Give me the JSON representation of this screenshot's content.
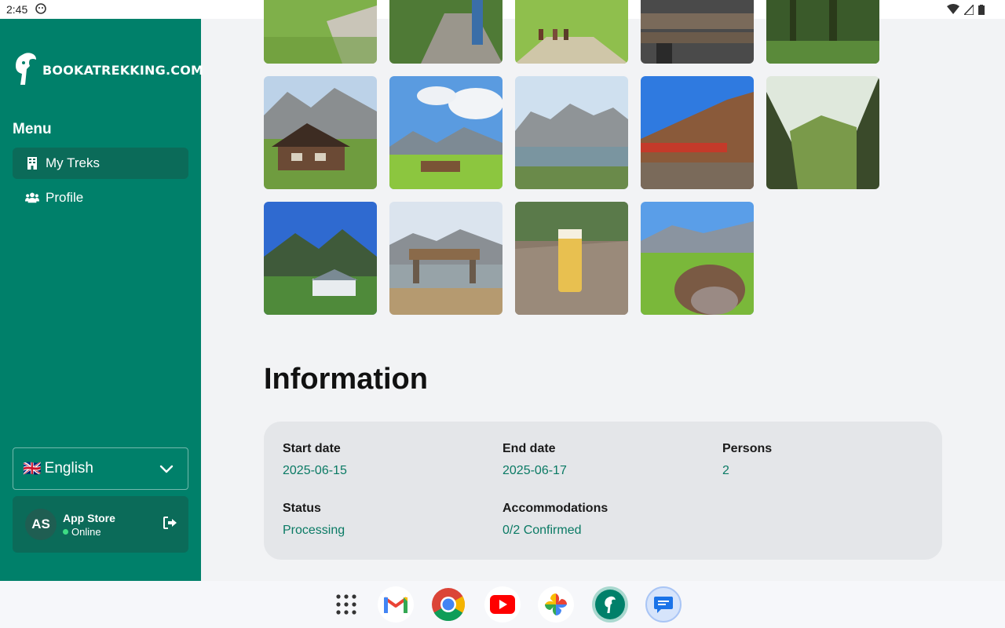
{
  "status_bar": {
    "time": "2:45"
  },
  "sidebar": {
    "brand": "BOOKATREKKING.COM",
    "menu_title": "Menu",
    "items": [
      {
        "label": "My Treks",
        "icon": "building-icon",
        "active": true
      },
      {
        "label": "Profile",
        "icon": "users-icon",
        "active": false
      }
    ],
    "language": {
      "flag": "🇬🇧",
      "label": "English"
    },
    "user": {
      "initials": "AS",
      "name": "App Store",
      "status": "Online"
    }
  },
  "gallery": {
    "photos": [
      "meadow-trail",
      "gravel-path-hiker",
      "hikers-meadow",
      "wooden-bench",
      "forest",
      "alpine-hut",
      "mountain-village",
      "mountain-lake",
      "mountain-hut-terrace",
      "valley-view",
      "alpine-chapel",
      "bench-lake",
      "beer-on-table",
      "cow-closeup"
    ]
  },
  "information": {
    "title": "Information",
    "fields": {
      "start_date": {
        "label": "Start date",
        "value": "2025-06-15"
      },
      "end_date": {
        "label": "End date",
        "value": "2025-06-17"
      },
      "persons": {
        "label": "Persons",
        "value": "2"
      },
      "status": {
        "label": "Status",
        "value": "Processing"
      },
      "accommodations": {
        "label": "Accommodations",
        "value": "0/2 Confirmed"
      }
    }
  },
  "taskbar": {
    "apps": [
      "app-drawer-icon",
      "gmail-icon",
      "chrome-icon",
      "youtube-icon",
      "photos-icon",
      "bookatrekking-app-icon",
      "messages-icon"
    ]
  },
  "colors": {
    "sidebar": "#00806a",
    "accent_text": "#0a7a64",
    "background": "#f2f3f5"
  }
}
